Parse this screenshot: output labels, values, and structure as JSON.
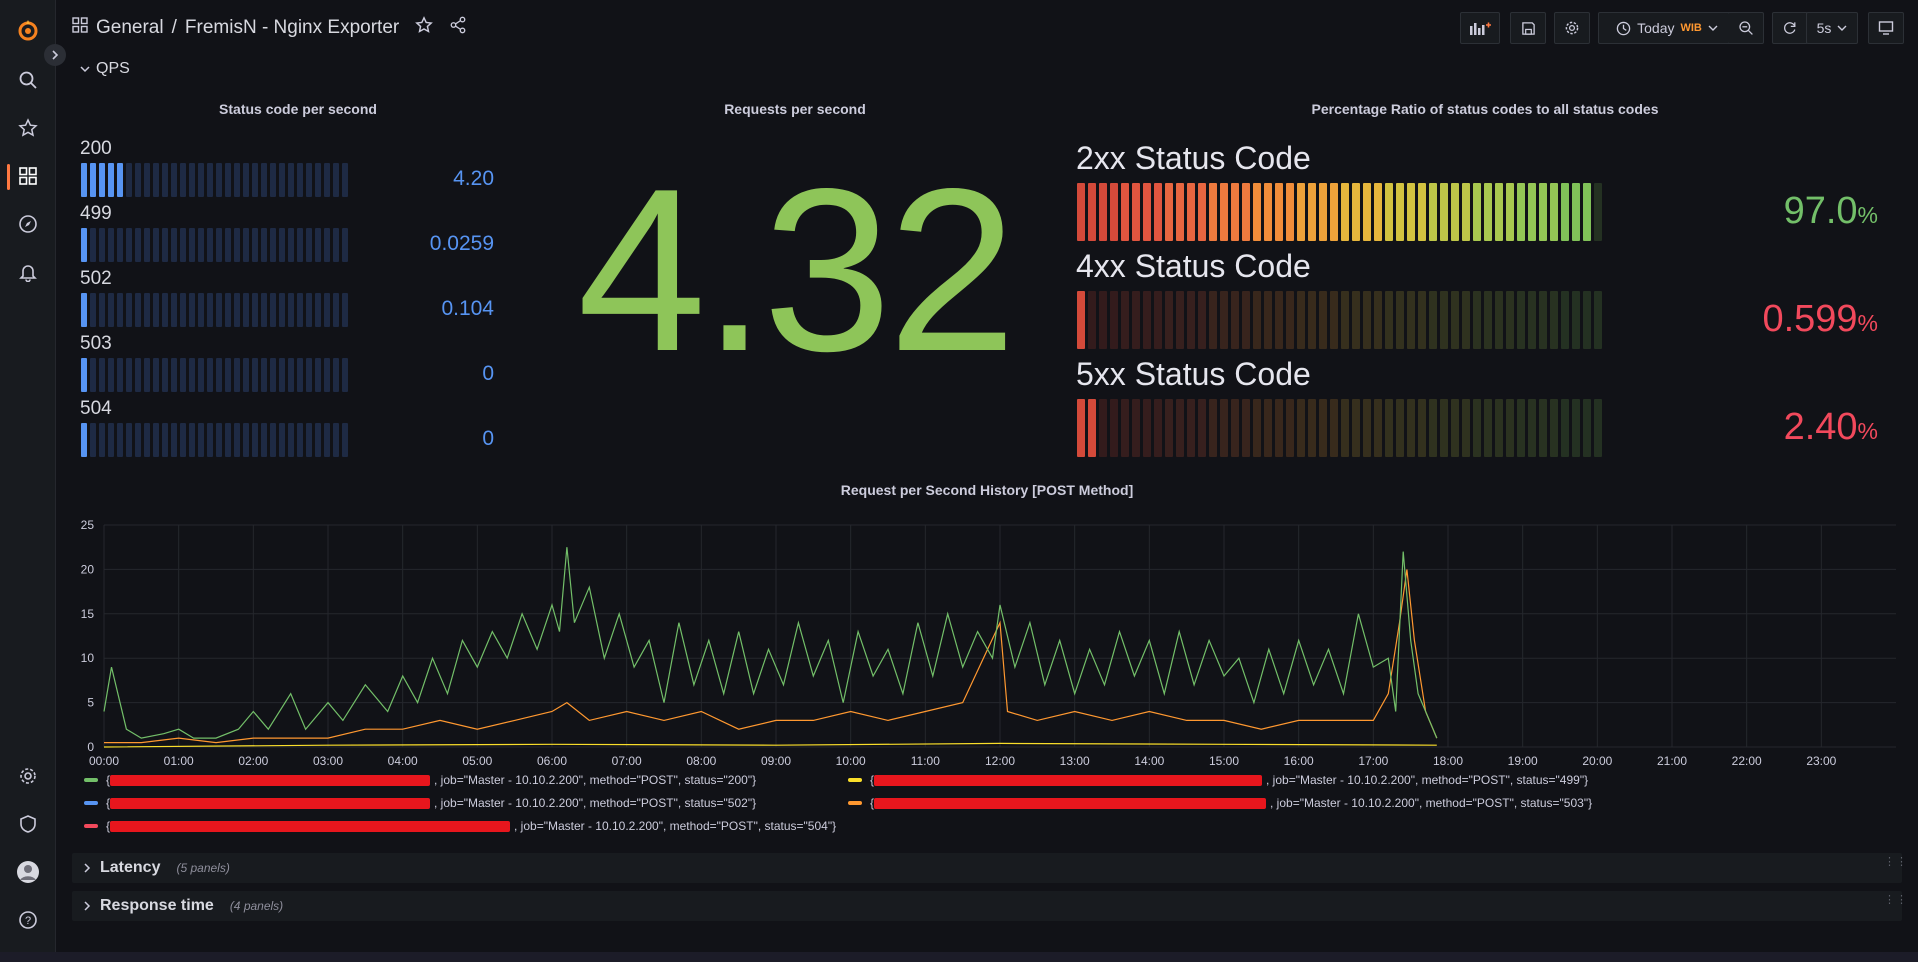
{
  "breadcrumb": {
    "folder": "General",
    "separator": "/",
    "title": "FremisN - Nginx Exporter"
  },
  "toolbar": {
    "time_range": "Today",
    "timezone": "WIB",
    "refresh_interval": "5s"
  },
  "row_qps": {
    "title": "QPS"
  },
  "status_panel": {
    "title": "Status code per second",
    "items": [
      {
        "label": "200",
        "value": "4.20",
        "fill": 0.17
      },
      {
        "label": "499",
        "value": "0.0259",
        "fill": 0.02
      },
      {
        "label": "502",
        "value": "0.104",
        "fill": 0.02
      },
      {
        "label": "503",
        "value": "0",
        "fill": 0.02
      },
      {
        "label": "504",
        "value": "0",
        "fill": 0.02
      }
    ]
  },
  "rps_panel": {
    "title": "Requests per second",
    "value": "4.32"
  },
  "ratio_panel": {
    "title": "Percentage Ratio of status codes to all status codes",
    "gauges": [
      {
        "label": "2xx Status Code",
        "value": "97.0",
        "unit": "%",
        "fill": 0.97,
        "color": "#73bf69"
      },
      {
        "label": "4xx Status Code",
        "value": "0.599",
        "unit": "%",
        "fill": 0.02,
        "color": "#f2495c"
      },
      {
        "label": "5xx Status Code",
        "value": "2.40",
        "unit": "%",
        "fill": 0.04,
        "color": "#f2495c"
      }
    ]
  },
  "history_panel": {
    "title": "Request per Second History [POST Method]",
    "legend": [
      {
        "color": "#73bf69",
        "text": ", job=\"Master - 10.10.2.200\", method=\"POST\", status=\"200\"}"
      },
      {
        "color": "#fade2a",
        "text": ", job=\"Master - 10.10.2.200\", method=\"POST\", status=\"499\"}"
      },
      {
        "color": "#5794f2",
        "text": ", job=\"Master - 10.10.2.200\", method=\"POST\", status=\"502\"}"
      },
      {
        "color": "#ff9830",
        "text": ", job=\"Master - 10.10.2.200\", method=\"POST\", status=\"503\"}"
      },
      {
        "color": "#f2495c",
        "text": ", job=\"Master - 10.10.2.200\", method=\"POST\", status=\"504\"}"
      }
    ]
  },
  "chart_data": {
    "type": "line",
    "title": "Request per Second History [POST Method]",
    "x_ticks": [
      "00:00",
      "01:00",
      "02:00",
      "03:00",
      "04:00",
      "05:00",
      "06:00",
      "07:00",
      "08:00",
      "09:00",
      "10:00",
      "11:00",
      "12:00",
      "13:00",
      "14:00",
      "15:00",
      "16:00",
      "17:00",
      "18:00",
      "19:00",
      "20:00",
      "21:00",
      "22:00",
      "23:00"
    ],
    "y_ticks": [
      0,
      5,
      10,
      15,
      20,
      25
    ],
    "ylim": [
      0,
      25
    ],
    "xlim_hours": [
      0,
      24
    ],
    "grid": true,
    "series": [
      {
        "color": "#73bf69",
        "points": [
          [
            0,
            4
          ],
          [
            0.1,
            9
          ],
          [
            0.3,
            2
          ],
          [
            0.5,
            1
          ],
          [
            0.8,
            1.5
          ],
          [
            1.0,
            2
          ],
          [
            1.2,
            1
          ],
          [
            1.5,
            1
          ],
          [
            1.8,
            2
          ],
          [
            2.0,
            4
          ],
          [
            2.2,
            2
          ],
          [
            2.5,
            6
          ],
          [
            2.7,
            2
          ],
          [
            3.0,
            5
          ],
          [
            3.2,
            3
          ],
          [
            3.5,
            7
          ],
          [
            3.8,
            4
          ],
          [
            4.0,
            8
          ],
          [
            4.2,
            5
          ],
          [
            4.4,
            10
          ],
          [
            4.6,
            6
          ],
          [
            4.8,
            12
          ],
          [
            5.0,
            9
          ],
          [
            5.2,
            13
          ],
          [
            5.4,
            10
          ],
          [
            5.6,
            15
          ],
          [
            5.8,
            11
          ],
          [
            6.0,
            16
          ],
          [
            6.1,
            13
          ],
          [
            6.2,
            22.5
          ],
          [
            6.3,
            14
          ],
          [
            6.5,
            18
          ],
          [
            6.7,
            10
          ],
          [
            6.9,
            15
          ],
          [
            7.1,
            9
          ],
          [
            7.3,
            12
          ],
          [
            7.5,
            5
          ],
          [
            7.7,
            14
          ],
          [
            7.9,
            7
          ],
          [
            8.1,
            12
          ],
          [
            8.3,
            6
          ],
          [
            8.5,
            13
          ],
          [
            8.7,
            6
          ],
          [
            8.9,
            11
          ],
          [
            9.1,
            7
          ],
          [
            9.3,
            14
          ],
          [
            9.5,
            8
          ],
          [
            9.7,
            12
          ],
          [
            9.9,
            5
          ],
          [
            10.1,
            13
          ],
          [
            10.3,
            8
          ],
          [
            10.5,
            11
          ],
          [
            10.7,
            6
          ],
          [
            10.9,
            14
          ],
          [
            11.1,
            8
          ],
          [
            11.3,
            15
          ],
          [
            11.5,
            9
          ],
          [
            11.7,
            13
          ],
          [
            11.9,
            10
          ],
          [
            12.0,
            16
          ],
          [
            12.2,
            9
          ],
          [
            12.4,
            14
          ],
          [
            12.6,
            7
          ],
          [
            12.8,
            12
          ],
          [
            13.0,
            6
          ],
          [
            13.2,
            11
          ],
          [
            13.4,
            7
          ],
          [
            13.6,
            13
          ],
          [
            13.8,
            8
          ],
          [
            14.0,
            12
          ],
          [
            14.2,
            6
          ],
          [
            14.4,
            13
          ],
          [
            14.6,
            7
          ],
          [
            14.8,
            12
          ],
          [
            15.0,
            8
          ],
          [
            15.2,
            10
          ],
          [
            15.4,
            5
          ],
          [
            15.6,
            11
          ],
          [
            15.8,
            6
          ],
          [
            16.0,
            12
          ],
          [
            16.2,
            7
          ],
          [
            16.4,
            11
          ],
          [
            16.6,
            6
          ],
          [
            16.8,
            15
          ],
          [
            17.0,
            9
          ],
          [
            17.2,
            10
          ],
          [
            17.3,
            4
          ],
          [
            17.4,
            22
          ],
          [
            17.5,
            12
          ],
          [
            17.6,
            6
          ],
          [
            17.8,
            2
          ],
          [
            17.85,
            1
          ]
        ]
      },
      {
        "color": "#ff9830",
        "points": [
          [
            0,
            0.5
          ],
          [
            0.5,
            0.5
          ],
          [
            1,
            1
          ],
          [
            1.5,
            0.5
          ],
          [
            2,
            1
          ],
          [
            2.5,
            1
          ],
          [
            3,
            1
          ],
          [
            3.5,
            2
          ],
          [
            4,
            2
          ],
          [
            4.5,
            3
          ],
          [
            5,
            2
          ],
          [
            5.5,
            3
          ],
          [
            6,
            4
          ],
          [
            6.2,
            5
          ],
          [
            6.5,
            3
          ],
          [
            7,
            4
          ],
          [
            7.5,
            3
          ],
          [
            8,
            4
          ],
          [
            8.5,
            2
          ],
          [
            9,
            3
          ],
          [
            9.5,
            3
          ],
          [
            10,
            4
          ],
          [
            10.5,
            3
          ],
          [
            11,
            4
          ],
          [
            11.5,
            5
          ],
          [
            12,
            14
          ],
          [
            12.1,
            4
          ],
          [
            12.5,
            3
          ],
          [
            13,
            4
          ],
          [
            13.5,
            3
          ],
          [
            14,
            4
          ],
          [
            14.5,
            3
          ],
          [
            15,
            3
          ],
          [
            15.5,
            2
          ],
          [
            16,
            3
          ],
          [
            16.5,
            3
          ],
          [
            17,
            3
          ],
          [
            17.2,
            6
          ],
          [
            17.35,
            14
          ],
          [
            17.45,
            20
          ],
          [
            17.55,
            12
          ],
          [
            17.7,
            4
          ],
          [
            17.85,
            1
          ]
        ]
      },
      {
        "color": "#fade2a",
        "points": [
          [
            0,
            0
          ],
          [
            3,
            0.2
          ],
          [
            6,
            0.3
          ],
          [
            9,
            0.2
          ],
          [
            12,
            0.4
          ],
          [
            15,
            0.3
          ],
          [
            17.85,
            0.2
          ]
        ]
      }
    ]
  },
  "collapsed_rows": [
    {
      "title": "Latency",
      "count": "(5 panels)"
    },
    {
      "title": "Response time",
      "count": "(4 panels)"
    }
  ]
}
